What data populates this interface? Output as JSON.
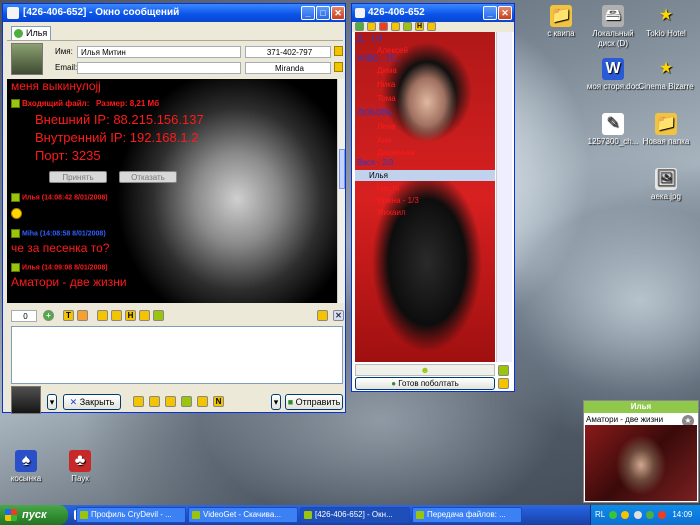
{
  "desktop": {
    "icons": [
      {
        "label": "с квипа",
        "glyph": "📁"
      },
      {
        "label": "Локальный диск (D)",
        "glyph": "🖴"
      },
      {
        "label": "Tokio Hotel",
        "glyph": "★"
      },
      {
        "label": "моя сторя.doc",
        "glyph": "W"
      },
      {
        "label": "Cinema Bizarre",
        "glyph": "★"
      },
      {
        "label": "1257300_ch...",
        "glyph": "✎"
      },
      {
        "label": "Новая папка",
        "glyph": "📁"
      },
      {
        "label": "аека.jpg",
        "glyph": "🖼"
      },
      {
        "label": "косынка",
        "glyph": "♠"
      },
      {
        "label": "Паук",
        "glyph": "♣"
      }
    ]
  },
  "message_window": {
    "title": "[426-406-652] - Окно сообщений",
    "tab_label": "Илья",
    "name_label": "Имя:",
    "name_value": "Илья Митин",
    "phone_value": "371-402-797",
    "email_label": "Email:",
    "client_value": "Miranda",
    "chat": {
      "line1": "меня выкинулоjj",
      "file_label": "Входящий файл:",
      "file_size": "Размер: 8,21 Мб",
      "ext_ip": "Внешний IP: 88.215.156.137",
      "int_ip": "Внутренний IP: 192.168.1.2",
      "port": "Порт: 3235",
      "accept": "Принять",
      "decline": "Отказать",
      "msg1_header": "Илья (14:08:42 8/01/2008)",
      "msg2_header": "Miha (14:08:58 8/01/2008)",
      "msg2_text": "че за песенка то?",
      "msg3_header": "Илья (14:09:08 8/01/2008)",
      "msg3_text": "Аматори - две жизни"
    },
    "char_count": "0",
    "close_button": "Закрыть",
    "send_button": "Отправить"
  },
  "contact_list": {
    "title": "426-406-652",
    "rows": [
      {
        "text": "Д... 1/3"
      },
      {
        "text": "ИЗВО...TE..."
      },
      {
        "text": "Алексей"
      },
      {
        "text": "Дима"
      },
      {
        "text": "Ника"
      },
      {
        "text": "Тома"
      },
      {
        "text": "ЛЮБОВЬ"
      },
      {
        "text": "Лена"
      },
      {
        "text": "Аня"
      },
      {
        "text": "Дашенька"
      }
    ],
    "section1": "Вася - 2/3",
    "selected_contact": "Илья",
    "rows2": [
      {
        "text": "Настя"
      },
      {
        "text": "Ирина - 1/3"
      },
      {
        "text": "Михаил"
      }
    ],
    "status_button": "Готов поболтать"
  },
  "popup": {
    "title": "Илья",
    "text": "Аматори - две жизни"
  },
  "taskbar": {
    "start": "пуск",
    "tasks": [
      {
        "label": "Профиль CryDevil - ..."
      },
      {
        "label": "VideoGet - Скачива..."
      },
      {
        "label": "[426-406-652] - Окн..."
      },
      {
        "label": "Передача файлов: ..."
      }
    ],
    "lang": "RL",
    "clock": "14:09"
  },
  "colors": {
    "chat_red": "#ff1a1a",
    "chat_green": "#3ac43a",
    "xp_blue": "#245edb"
  }
}
